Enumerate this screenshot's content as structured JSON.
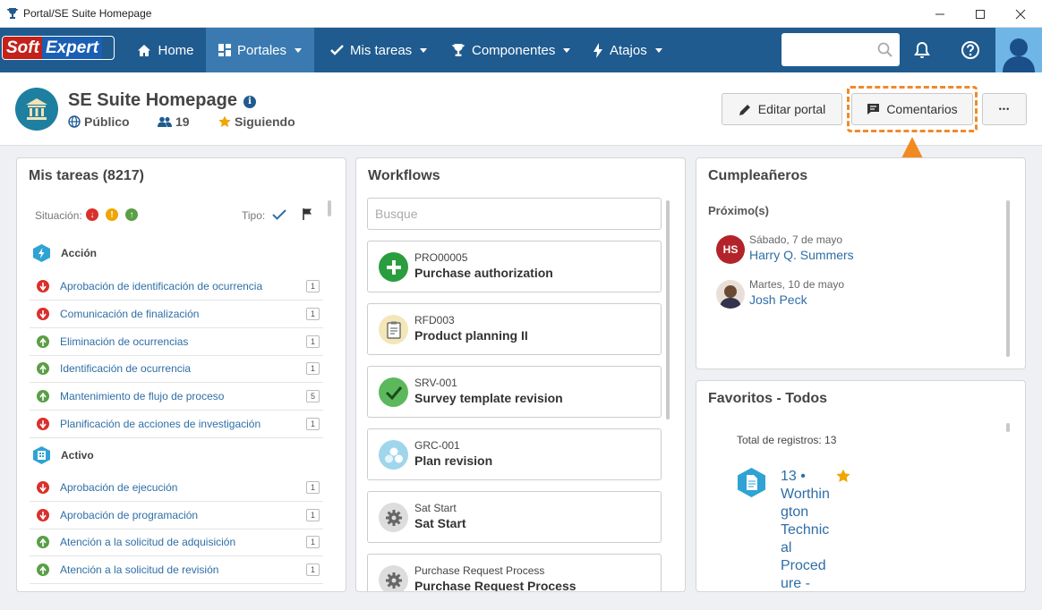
{
  "window": {
    "title": "Portal/SE Suite Homepage"
  },
  "logo": {
    "soft": "Soft",
    "expert": "Expert"
  },
  "nav": {
    "items": [
      {
        "label": "Home"
      },
      {
        "label": "Portales"
      },
      {
        "label": "Mis tareas"
      },
      {
        "label": "Componentes"
      },
      {
        "label": "Atajos"
      }
    ],
    "search_placeholder": ""
  },
  "header": {
    "title": "SE Suite Homepage",
    "visibility": "Público",
    "followers": "19",
    "following": "Siguiendo",
    "edit_label": "Editar portal",
    "comments_label": "Comentarios",
    "more_label": "•••"
  },
  "tasks": {
    "title": "Mis tareas (8217)",
    "situation_label": "Situación:",
    "type_label": "Tipo:",
    "groups": [
      {
        "name": "Acción",
        "items": [
          {
            "label": "Aprobación de identificación de ocurrencia",
            "count": "1",
            "status": "red"
          },
          {
            "label": "Comunicación de finalización",
            "count": "1",
            "status": "red"
          },
          {
            "label": "Eliminación de ocurrencias",
            "count": "1",
            "status": "green"
          },
          {
            "label": "Identificación de ocurrencia",
            "count": "1",
            "status": "green"
          },
          {
            "label": "Mantenimiento de flujo de proceso",
            "count": "5",
            "status": "green"
          },
          {
            "label": "Planificación de acciones de investigación",
            "count": "1",
            "status": "red"
          }
        ]
      },
      {
        "name": "Activo",
        "items": [
          {
            "label": "Aprobación de ejecución",
            "count": "1",
            "status": "red"
          },
          {
            "label": "Aprobación de programación",
            "count": "1",
            "status": "red"
          },
          {
            "label": "Atención a la solicitud de adquisición",
            "count": "1",
            "status": "green"
          },
          {
            "label": "Atención a la solicitud de revisión",
            "count": "1",
            "status": "green"
          }
        ]
      }
    ]
  },
  "workflows": {
    "title": "Workflows",
    "search_placeholder": "Busque",
    "items": [
      {
        "code": "PRO00005",
        "name": "Purchase authorization",
        "icon": "plus-icon"
      },
      {
        "code": "RFD003",
        "name": "Product planning II",
        "icon": "clipboard-icon"
      },
      {
        "code": "SRV-001",
        "name": "Survey template revision",
        "icon": "check-icon"
      },
      {
        "code": "GRC-001",
        "name": "Plan revision",
        "icon": "network-icon"
      },
      {
        "code": "Sat Start",
        "name": "Sat Start",
        "icon": "gear-icon"
      },
      {
        "code": "Purchase Request Process",
        "name": "Purchase Request Process",
        "icon": "gear-icon"
      }
    ]
  },
  "birthdays": {
    "title": "Cumpleañeros",
    "subtitle": "Próximo(s)",
    "items": [
      {
        "date": "Sábado, 7 de mayo",
        "name": "Harry Q. Summers",
        "initials": "HS"
      },
      {
        "date": "Martes, 10 de mayo",
        "name": "Josh Peck",
        "initials": ""
      }
    ]
  },
  "favorites": {
    "title": "Favoritos - Todos",
    "total": "Total de registros: 13",
    "item_lines": [
      "13 •",
      "Worthin",
      "gton",
      "Technic",
      "al",
      "Proced",
      "ure -"
    ]
  },
  "colors": {
    "nav": "#1f5b8f",
    "accent": "#ef8a2a",
    "link": "#2f6ea6"
  }
}
